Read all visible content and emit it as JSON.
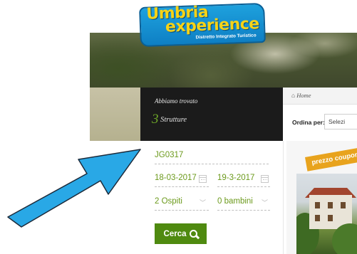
{
  "brand": {
    "line1": "Umbria",
    "line2": "experience",
    "tagline": "Distretto Integrato Turistico"
  },
  "results": {
    "heading": "Abbiamo trovato",
    "count": "3",
    "label": "Strutture"
  },
  "breadcrumb": {
    "home": "Home"
  },
  "sort": {
    "label": "Ordina per:",
    "selected": "Selezi"
  },
  "search": {
    "code": "JG0317",
    "checkin": "18-03-2017",
    "checkout": "19-3-2017",
    "guests": "2 Ospiti",
    "children": "0 bambini",
    "button": "Cerca"
  },
  "card": {
    "badge": "prezzo coupon"
  },
  "colors": {
    "accent_green": "#4f8a10",
    "value_green": "#6c9a1c",
    "logo_blue": "#1ea1dd",
    "logo_yellow": "#f6d317",
    "badge_orange": "#e8a31d",
    "arrow_blue": "#29a8e6"
  },
  "icons": {
    "home": "home-icon",
    "calendar": "calendar-icon",
    "chevron": "chevron-down-icon",
    "search": "search-icon"
  }
}
